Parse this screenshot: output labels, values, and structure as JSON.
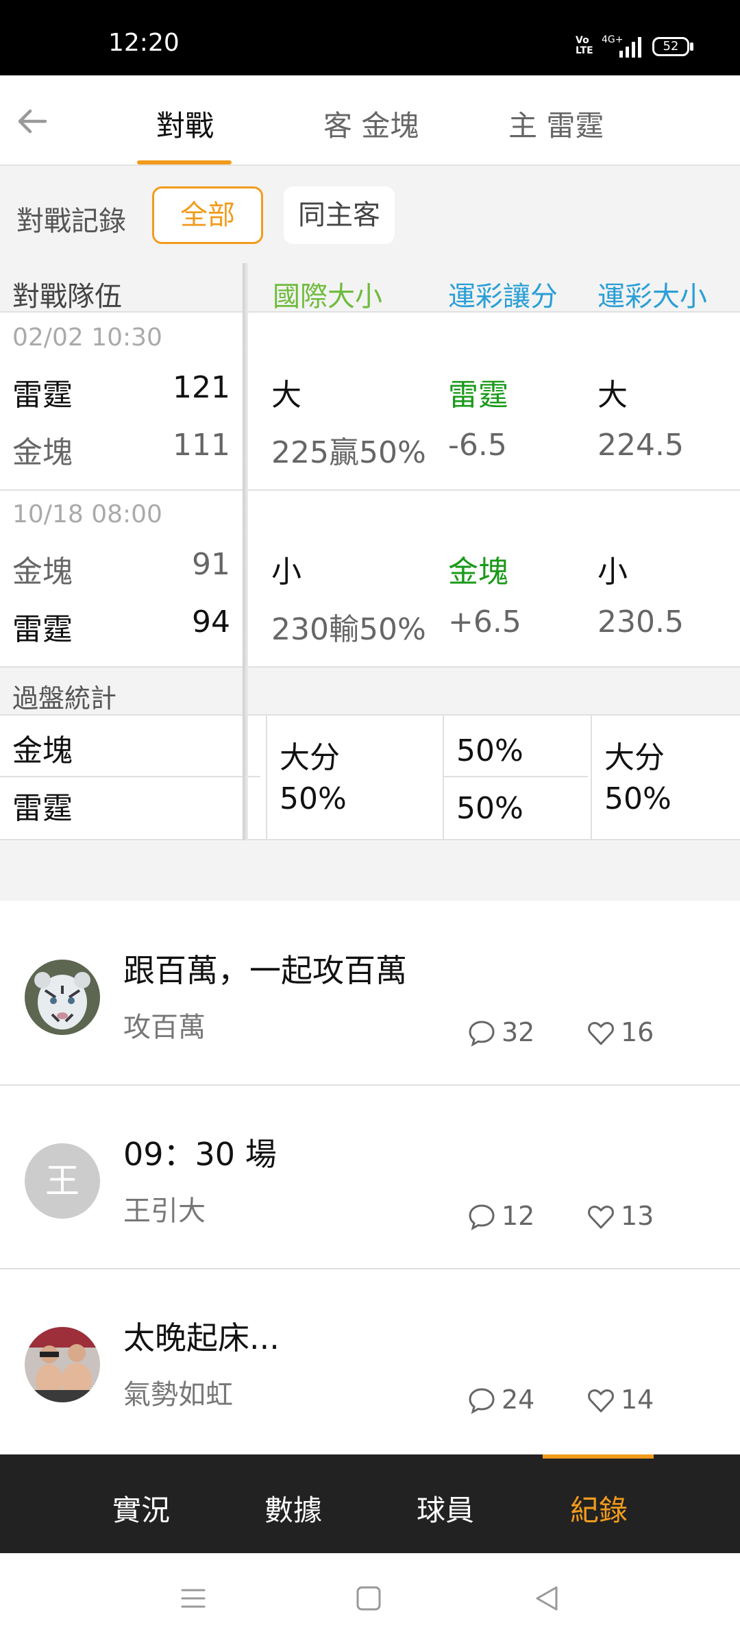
{
  "status_bar": {
    "time": "12:20",
    "volte": "Vo\nLTE",
    "network": "4G+",
    "battery": "52"
  },
  "top_tabs": {
    "matchup": "對戰",
    "away": "客 金塊",
    "home": "主 雷霆"
  },
  "filters": {
    "label": "對戰記錄",
    "all": "全部",
    "same_home_away": "同主客"
  },
  "table_header": {
    "teams": "對戰隊伍",
    "intl_ou": "國際大小",
    "spread": "運彩讓分",
    "total": "運彩大小"
  },
  "matches": [
    {
      "date": "02/02 10:30",
      "team1": "雷霆",
      "score1": "121",
      "team2": "金塊",
      "score2": "111",
      "intl_result": "大",
      "intl_line": "225贏50%",
      "spread_team": "雷霆",
      "spread_line": "-6.5",
      "total_result": "大",
      "total_line": "224.5"
    },
    {
      "date": "10/18 08:00",
      "team1": "金塊",
      "score1": "91",
      "team2": "雷霆",
      "score2": "94",
      "intl_result": "小",
      "intl_line": "230輸50%",
      "spread_team": "金塊",
      "spread_line": "+6.5",
      "total_result": "小",
      "total_line": "230.5"
    }
  ],
  "stats": {
    "title": "過盤統計",
    "team1": "金塊",
    "team2": "雷霆",
    "intl_label": "大分",
    "intl_pct": "50%",
    "spread_pct1": "50%",
    "spread_pct2": "50%",
    "total_label": "大分",
    "total_pct": "50%"
  },
  "posts": [
    {
      "title": "跟百萬，一起攻百萬",
      "author": "攻百萬",
      "comments": "32",
      "likes": "16",
      "avatar": "white-tiger-photo"
    },
    {
      "title": "09：30  場",
      "author": "王引大",
      "comments": "12",
      "likes": "13",
      "avatar_text": "王"
    },
    {
      "title": "太晚起床...",
      "author": "氣勢如虹",
      "comments": "24",
      "likes": "14",
      "avatar": "two-men-photo"
    }
  ],
  "bottom_nav": {
    "live": "實況",
    "data": "數據",
    "players": "球員",
    "records": "紀錄"
  },
  "colors": {
    "accent": "#f29b1c",
    "green": "#1a9a1a",
    "blue": "#2a9fd6",
    "light_green": "#6ebb3c"
  }
}
